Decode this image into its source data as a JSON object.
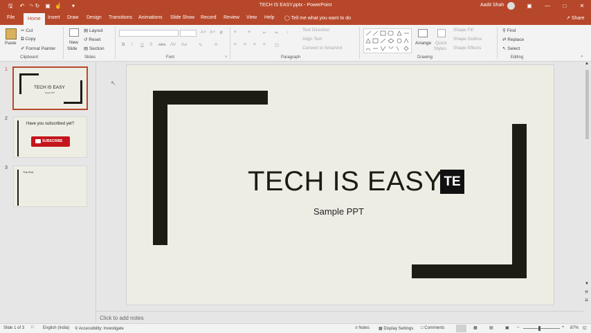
{
  "titlebar": {
    "title": "TECH IS EASY.pptx  -  PowerPoint",
    "user": "Aadit Shah",
    "accent": "#b7472a"
  },
  "tabs": [
    "File",
    "Home",
    "Insert",
    "Draw",
    "Design",
    "Transitions",
    "Animations",
    "Slide Show",
    "Record",
    "Review",
    "View",
    "Help"
  ],
  "active_tab": "Home",
  "tell_me": "Tell me what you want to do",
  "share": "Share",
  "ribbon": {
    "clipboard": {
      "paste": "Paste",
      "cut": "Cut",
      "copy": "Copy",
      "format_painter": "Format Painter",
      "label": "Clipboard"
    },
    "slides": {
      "new_slide": "New",
      "new_slide2": "Slide",
      "layout": "Layout",
      "reset": "Reset",
      "section": "Section",
      "label": "Slides"
    },
    "font": {
      "label": "Font",
      "bold": "B",
      "italic": "I",
      "underline": "U",
      "strike": "S",
      "aa": "Aa",
      "a": "A"
    },
    "paragraph": {
      "text_direction": "Text Direction",
      "align_text": "Align Text",
      "convert_smartart": "Convert to SmartArt",
      "label": "Paragraph"
    },
    "drawing": {
      "arrange": "Arrange",
      "quick_styles": "Quick",
      "quick_styles2": "Styles",
      "shape_fill": "Shape Fill",
      "shape_outline": "Shape Outline",
      "shape_effects": "Shape Effects",
      "label": "Drawing"
    },
    "editing": {
      "find": "Find",
      "replace": "Replace",
      "select": "Select",
      "label": "Editing"
    }
  },
  "thumbnails": [
    {
      "num": "1",
      "title": "TECH IS EASY",
      "sub": "Sample PPT"
    },
    {
      "num": "2",
      "title": "Have you subscribed yet?",
      "button": "SUBSCRIBE"
    },
    {
      "num": "3",
      "title": "The End"
    }
  ],
  "slide": {
    "title": "TECH IS EASY",
    "logo": "TE",
    "subtitle": "Sample PPT"
  },
  "notes_placeholder": "Click to add notes",
  "status": {
    "slide": "Slide 1 of 3",
    "language": "English (India)",
    "accessibility": "Accessibility: Investigate",
    "notes": "Notes",
    "display_settings": "Display Settings",
    "comments": "Comments",
    "zoom": "87%"
  }
}
